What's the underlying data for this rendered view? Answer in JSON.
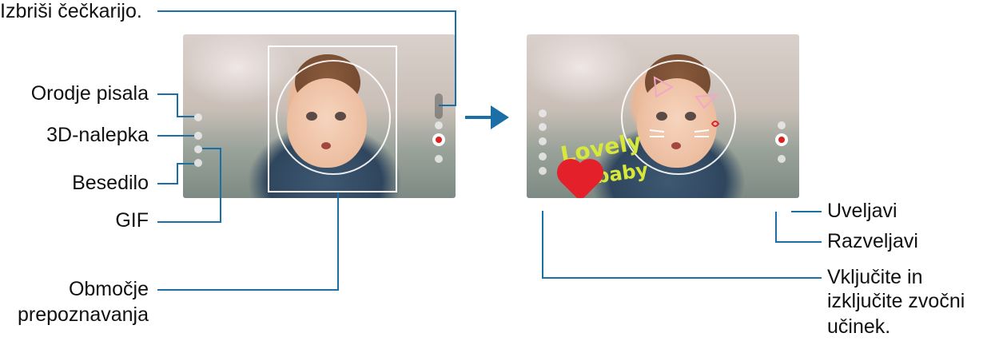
{
  "labels": {
    "erase_drawing": "Izbriši čečkarijo.",
    "pen_tool": "Orodje pisala",
    "sticker_3d": "3D-nalepka",
    "text": "Besedilo",
    "gif": "GIF",
    "recognition_area_line1": "Območje",
    "recognition_area_line2": "prepoznavanja",
    "apply": "Uveljavi",
    "undo": "Razveljavi",
    "sound_line1": "Vključite in",
    "sound_line2": "izključite zvočni",
    "sound_line3": "učinek."
  },
  "doodle": {
    "word1": "Lovely",
    "word2": "baby",
    "text_color": "#d7e83a"
  },
  "icons": {
    "arrow": "right-arrow-icon",
    "record": "record-icon",
    "pen": "pen-icon",
    "sticker": "sticker-icon",
    "text": "text-icon",
    "gif": "gif-icon",
    "sound": "sound-icon",
    "apply": "apply-button",
    "undo": "undo-icon"
  },
  "colors": {
    "callout_line": "#1a6fa6",
    "arrow": "#1a6fa6",
    "record": "#e02020",
    "heart": "#e4202a"
  }
}
